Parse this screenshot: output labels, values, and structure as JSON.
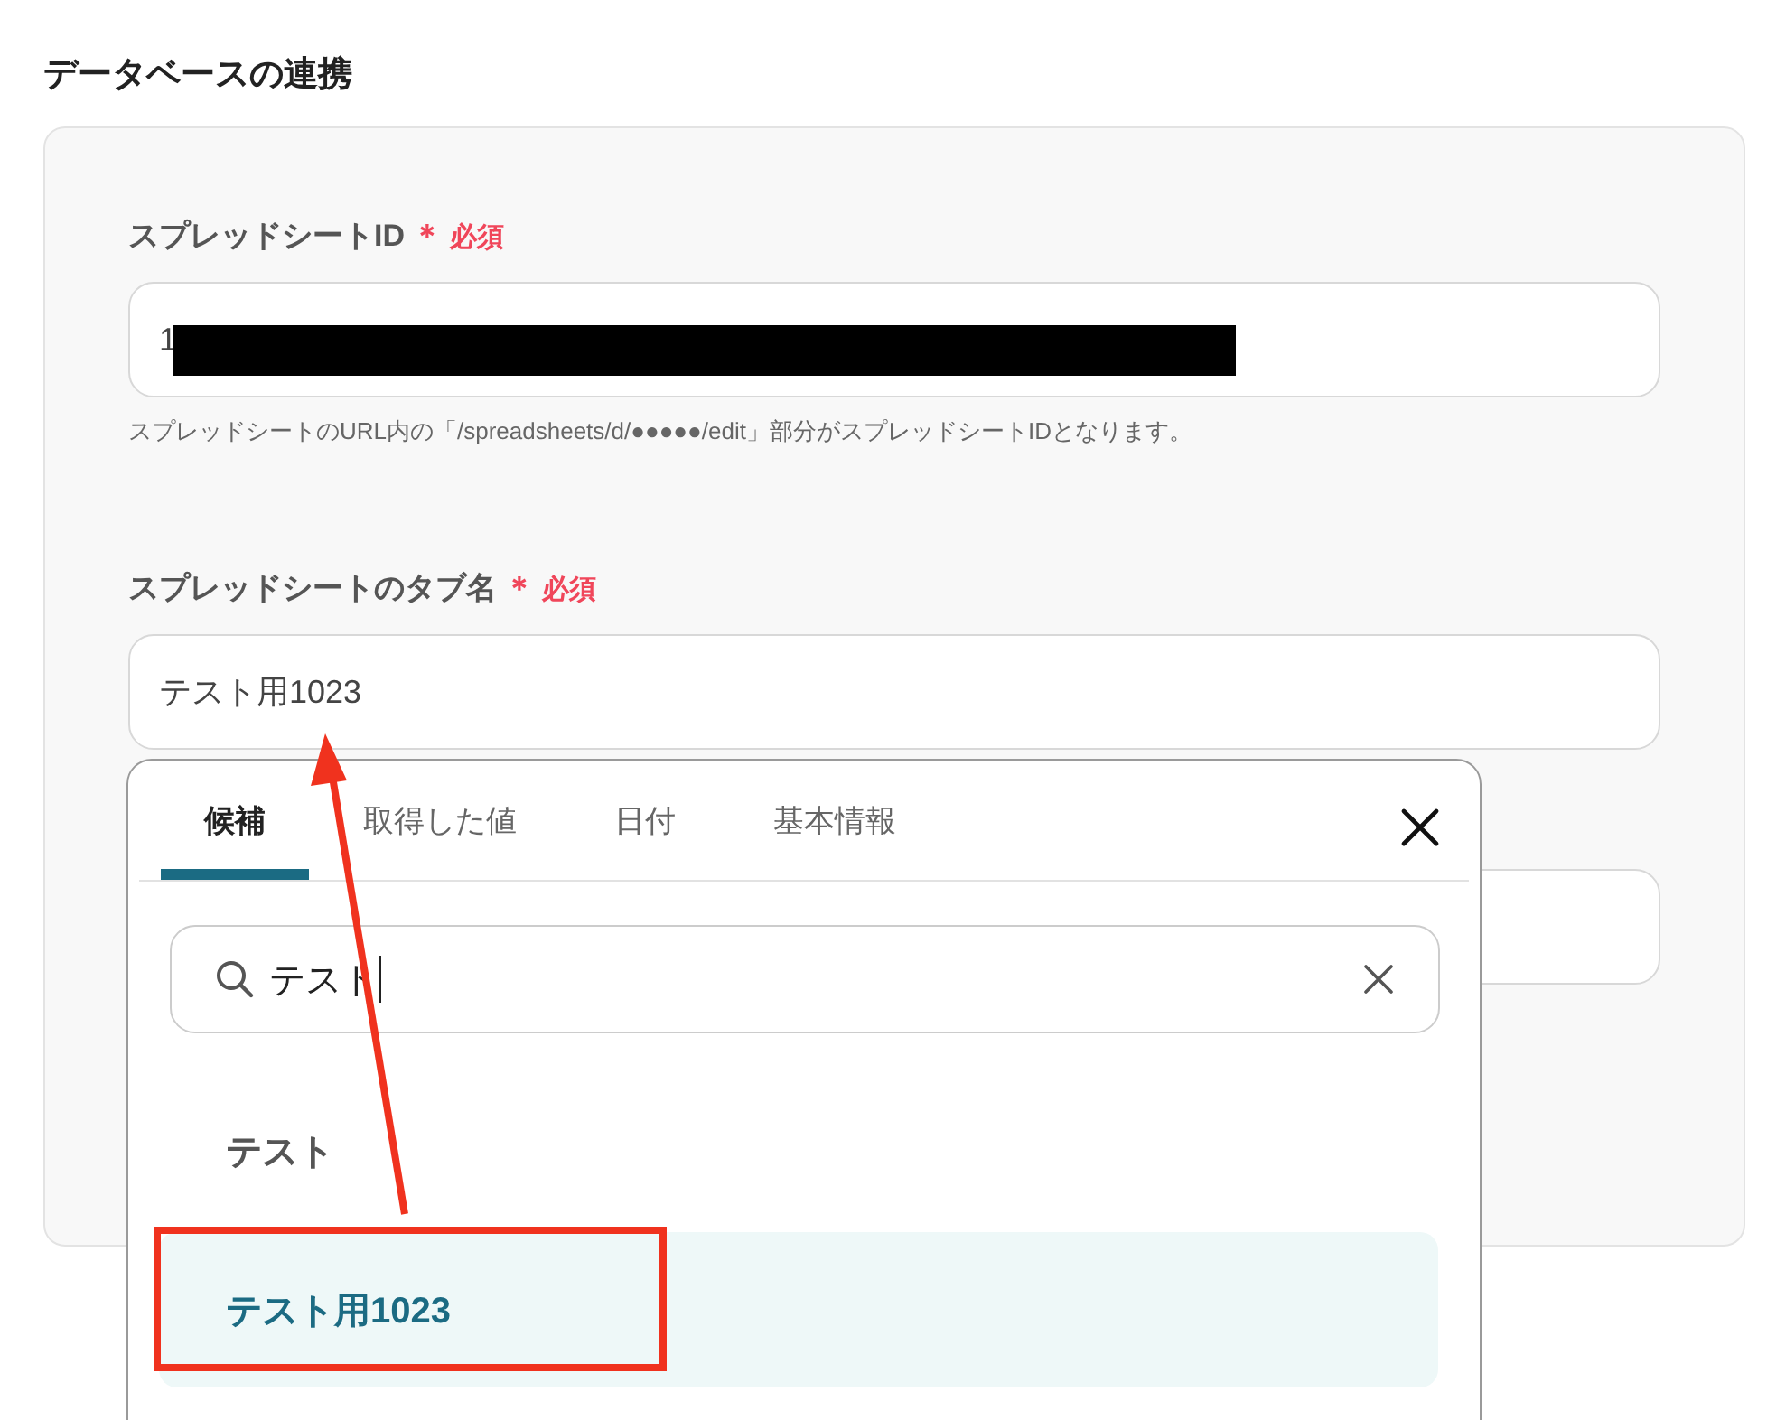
{
  "section_title": "データベースの連携",
  "fields": [
    {
      "label": "スプレッドシートID",
      "required_mark": "＊",
      "required_text": "必須",
      "value": "1",
      "redacted": true,
      "help": "スプレッドシートのURL内の「/spreadsheets/d/●●●●●/edit」部分がスプレッドシートIDとなります。"
    },
    {
      "label": "スプレッドシートのタブ名",
      "required_mark": "＊",
      "required_text": "必須",
      "value": "テスト用1023"
    }
  ],
  "popup": {
    "tabs": [
      {
        "label": "候補",
        "selected": true
      },
      {
        "label": "取得した値",
        "selected": false
      },
      {
        "label": "日付",
        "selected": false
      },
      {
        "label": "基本情報",
        "selected": false
      }
    ],
    "search": {
      "value": "テスト"
    },
    "options": [
      {
        "label": "テスト",
        "selected": false
      },
      {
        "label": "テスト用1023",
        "selected": true
      }
    ]
  }
}
